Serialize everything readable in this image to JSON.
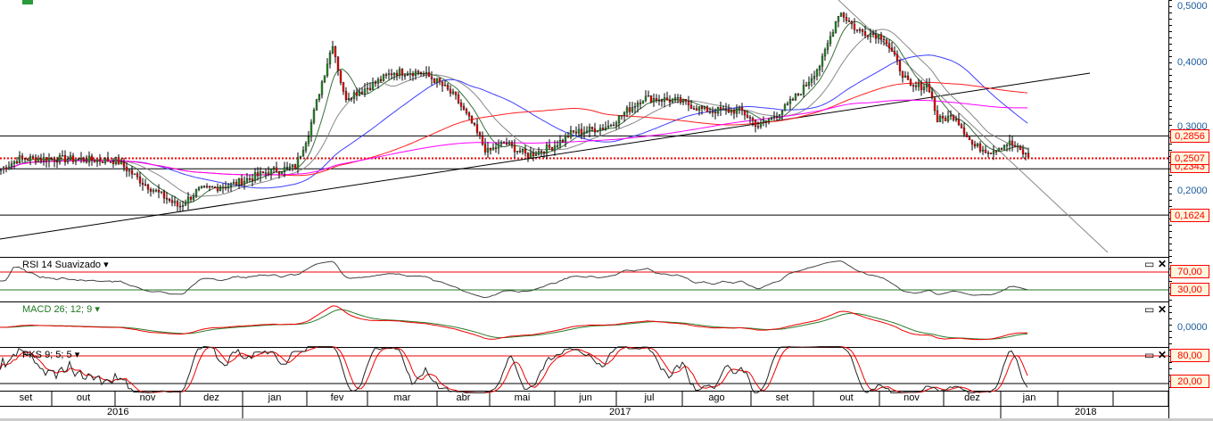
{
  "chart_data": {
    "type": "candlestick",
    "price_axis": {
      "ticks": [
        "0,5000",
        "0,4000",
        "0,3000",
        "0,2000"
      ],
      "tick_values": [
        0.5,
        0.4,
        0.3,
        0.2
      ],
      "range": [
        0.12,
        0.5
      ]
    },
    "price_keypoints": [
      [
        0,
        0.233
      ],
      [
        20,
        0.25
      ],
      [
        60,
        0.25
      ],
      [
        130,
        0.247
      ],
      [
        160,
        0.212
      ],
      [
        200,
        0.175
      ],
      [
        220,
        0.2
      ],
      [
        260,
        0.21
      ],
      [
        300,
        0.23
      ],
      [
        330,
        0.237
      ],
      [
        345,
        0.29
      ],
      [
        360,
        0.37
      ],
      [
        372,
        0.43
      ],
      [
        385,
        0.345
      ],
      [
        410,
        0.36
      ],
      [
        440,
        0.385
      ],
      [
        470,
        0.385
      ],
      [
        490,
        0.37
      ],
      [
        510,
        0.345
      ],
      [
        530,
        0.3
      ],
      [
        545,
        0.26
      ],
      [
        565,
        0.275
      ],
      [
        590,
        0.255
      ],
      [
        620,
        0.27
      ],
      [
        640,
        0.29
      ],
      [
        680,
        0.3
      ],
      [
        720,
        0.345
      ],
      [
        760,
        0.34
      ],
      [
        790,
        0.325
      ],
      [
        830,
        0.325
      ],
      [
        850,
        0.3
      ],
      [
        880,
        0.33
      ],
      [
        900,
        0.36
      ],
      [
        920,
        0.4
      ],
      [
        940,
        0.48
      ],
      [
        960,
        0.45
      ],
      [
        990,
        0.44
      ],
      [
        1010,
        0.385
      ],
      [
        1020,
        0.36
      ],
      [
        1040,
        0.365
      ],
      [
        1050,
        0.31
      ],
      [
        1070,
        0.317
      ],
      [
        1090,
        0.27
      ],
      [
        1110,
        0.262
      ],
      [
        1130,
        0.275
      ],
      [
        1152,
        0.253
      ]
    ],
    "horizontal_levels": [
      {
        "label": "0,2856",
        "value": 0.2856
      },
      {
        "label": "0,2507",
        "value": 0.2507,
        "style": "dotted-red"
      },
      {
        "label": "0,2343",
        "value": 0.2343
      },
      {
        "label": "0,1624",
        "value": 0.1624
      }
    ],
    "moving_averages": [
      {
        "period": 9,
        "color": "#3a6e3a"
      },
      {
        "period": 21,
        "color": "#888888"
      },
      {
        "period": 50,
        "color": "#4040ff"
      },
      {
        "period": 100,
        "color": "#ff2020"
      },
      {
        "period": 200,
        "color": "#ff00ff"
      }
    ],
    "indicators": [
      {
        "name": "RSI 14 Suavizado",
        "levels": [
          {
            "label": "70,00",
            "value": 70
          },
          {
            "label": "30,00",
            "value": 30
          }
        ]
      },
      {
        "name": "MACD 26; 12; 9",
        "axis_label": "0,0000"
      },
      {
        "name": "PKS 9; 5; 5",
        "levels": [
          {
            "label": "80,00",
            "value": 80
          },
          {
            "label": "20,00",
            "value": 20
          }
        ]
      }
    ],
    "months": [
      {
        "l": "set",
        "a": 0,
        "b": 58
      },
      {
        "l": "out",
        "a": 58,
        "b": 129
      },
      {
        "l": "nov",
        "a": 129,
        "b": 202
      },
      {
        "l": "dez",
        "a": 202,
        "b": 272
      },
      {
        "l": "jan",
        "a": 272,
        "b": 344
      },
      {
        "l": "fev",
        "a": 344,
        "b": 412
      },
      {
        "l": "mar",
        "a": 412,
        "b": 490
      },
      {
        "l": "abr",
        "a": 490,
        "b": 549
      },
      {
        "l": "mai",
        "a": 549,
        "b": 622
      },
      {
        "l": "jun",
        "a": 622,
        "b": 691
      },
      {
        "l": "jul",
        "a": 691,
        "b": 765
      },
      {
        "l": "ago",
        "a": 765,
        "b": 842
      },
      {
        "l": "set",
        "a": 842,
        "b": 912
      },
      {
        "l": "out",
        "a": 912,
        "b": 986
      },
      {
        "l": "nov",
        "a": 986,
        "b": 1058
      },
      {
        "l": "dez",
        "a": 1058,
        "b": 1122
      },
      {
        "l": "jan",
        "a": 1122,
        "b": 1186
      },
      {
        "l": "",
        "a": 1186,
        "b": 1248
      },
      {
        "l": "",
        "a": 1248,
        "b": 1310
      }
    ],
    "years": [
      "2016",
      "2017",
      "2018"
    ]
  }
}
